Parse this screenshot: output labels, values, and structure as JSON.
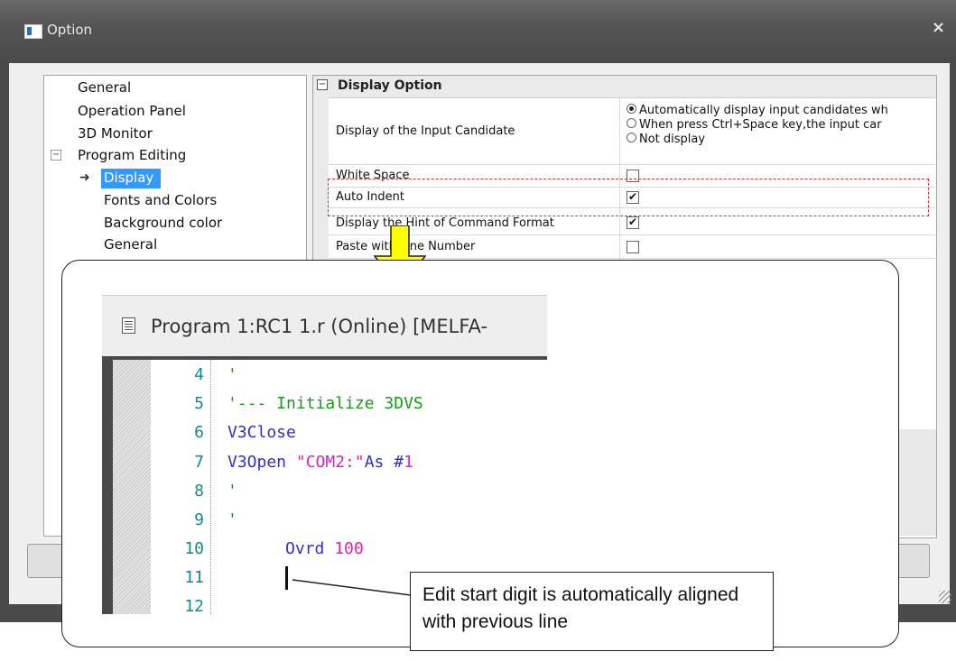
{
  "dialog": {
    "title": "Option",
    "close_glyph": "×"
  },
  "tree": {
    "items": [
      {
        "label": "General"
      },
      {
        "label": "Operation Panel"
      },
      {
        "label": "3D Monitor"
      },
      {
        "label": "Program Editing"
      },
      {
        "label": "Display"
      },
      {
        "label": "Fonts and Colors"
      },
      {
        "label": "Background color"
      },
      {
        "label": "General"
      }
    ],
    "selected": "Display",
    "expander_glyph": "−",
    "arrow_glyph": "➜"
  },
  "grid": {
    "section_title": "Display Option",
    "collapse_glyph": "−",
    "rows": {
      "input_candidate": {
        "label": "Display of the Input Candidate",
        "options": [
          "Automatically display input candidates wh",
          "When press Ctrl+Space key,the input car",
          "Not display"
        ],
        "selected_index": 0
      },
      "white_space": {
        "label": "White Space",
        "checked": false
      },
      "auto_indent": {
        "label": "Auto Indent",
        "checked": true,
        "check_glyph": "✔"
      },
      "hint": {
        "label": "Display the Hint of Command Format",
        "checked": true,
        "check_glyph": "✔"
      },
      "paste": {
        "label": "Paste with Line Number",
        "checked": false
      }
    }
  },
  "editor": {
    "title": "Program 1:RC1 1.r (Online)   [MELFA-",
    "lines": [
      {
        "num": "4"
      },
      {
        "num": "5"
      },
      {
        "num": "6"
      },
      {
        "num": "7"
      },
      {
        "num": "8"
      },
      {
        "num": "9"
      },
      {
        "num": "10"
      },
      {
        "num": "11"
      },
      {
        "num": "12"
      }
    ],
    "code": {
      "l4": "'",
      "l5": "'--- Initialize 3DVS",
      "l6": "V3Close",
      "l7_kw": "V3Open ",
      "l7_str": "\"COM2:\"",
      "l7_as": "As #",
      "l7_num": "1",
      "l8": "'",
      "l9": "'",
      "l10_kw": "Ovrd ",
      "l10_num": "100"
    }
  },
  "note": {
    "text": "Edit start digit is automatically aligned with previous line"
  },
  "colors": {
    "highlight": "#e53030",
    "arrow": "#ffff00",
    "selection": "#3399ff"
  }
}
